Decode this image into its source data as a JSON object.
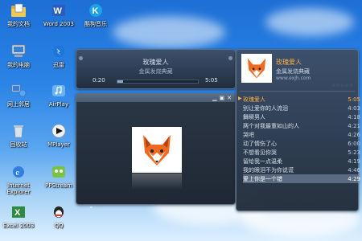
{
  "desktop_icons": [
    {
      "label": "我的文档",
      "icon": "folder-doc-icon"
    },
    {
      "label": "我的电脑",
      "icon": "computer-icon"
    },
    {
      "label": "网上邻居",
      "icon": "network-icon"
    },
    {
      "label": "回收站",
      "icon": "recycle-bin-icon"
    },
    {
      "label": "Internet Explorer",
      "icon": "ie-icon"
    },
    {
      "label": "Excel 2003",
      "icon": "excel-icon"
    },
    {
      "label": "Word 2003",
      "icon": "word-icon"
    },
    {
      "label": "迅雷",
      "icon": "thunder-icon"
    },
    {
      "label": "AirPlay",
      "icon": "airplay-icon"
    },
    {
      "label": "MPlayer",
      "icon": "mplayer-icon"
    },
    {
      "label": "PPStream",
      "icon": "ppstream-icon"
    },
    {
      "label": "QQ",
      "icon": "qq-icon"
    },
    {
      "label": "酷狗音乐",
      "icon": "kugou-icon"
    }
  ],
  "mini_player": {
    "song_title": "玫瑰爱人",
    "subtitle": "金属发烧典藏",
    "time_elapsed": "0:20",
    "time_total": "5:05",
    "progress": 0.07
  },
  "video_panel": {
    "accent": "#ff6a00"
  },
  "playlist": {
    "header_title": "玫瑰爱人",
    "header_album": "金属发烧典藏",
    "header_url": "www.exjh.com",
    "items": [
      {
        "title": "玫瑰爱人",
        "time": "5:05"
      },
      {
        "title": "别让爱你的人流泪",
        "time": "4:03"
      },
      {
        "title": "舞瞬男人",
        "time": "4:18"
      },
      {
        "title": "两个对我最重如山的人",
        "time": "4:21"
      },
      {
        "title": "哭吧",
        "time": "4:26"
      },
      {
        "title": "动了情伤了心",
        "time": "6:00"
      },
      {
        "title": "不想看见你哭",
        "time": "5:23"
      },
      {
        "title": "留给我一点温柔",
        "time": "4:19"
      },
      {
        "title": "我的眼泪不为你说谎",
        "time": "4:46"
      },
      {
        "title": "爱上你是一个错",
        "time": "4:29"
      }
    ]
  }
}
